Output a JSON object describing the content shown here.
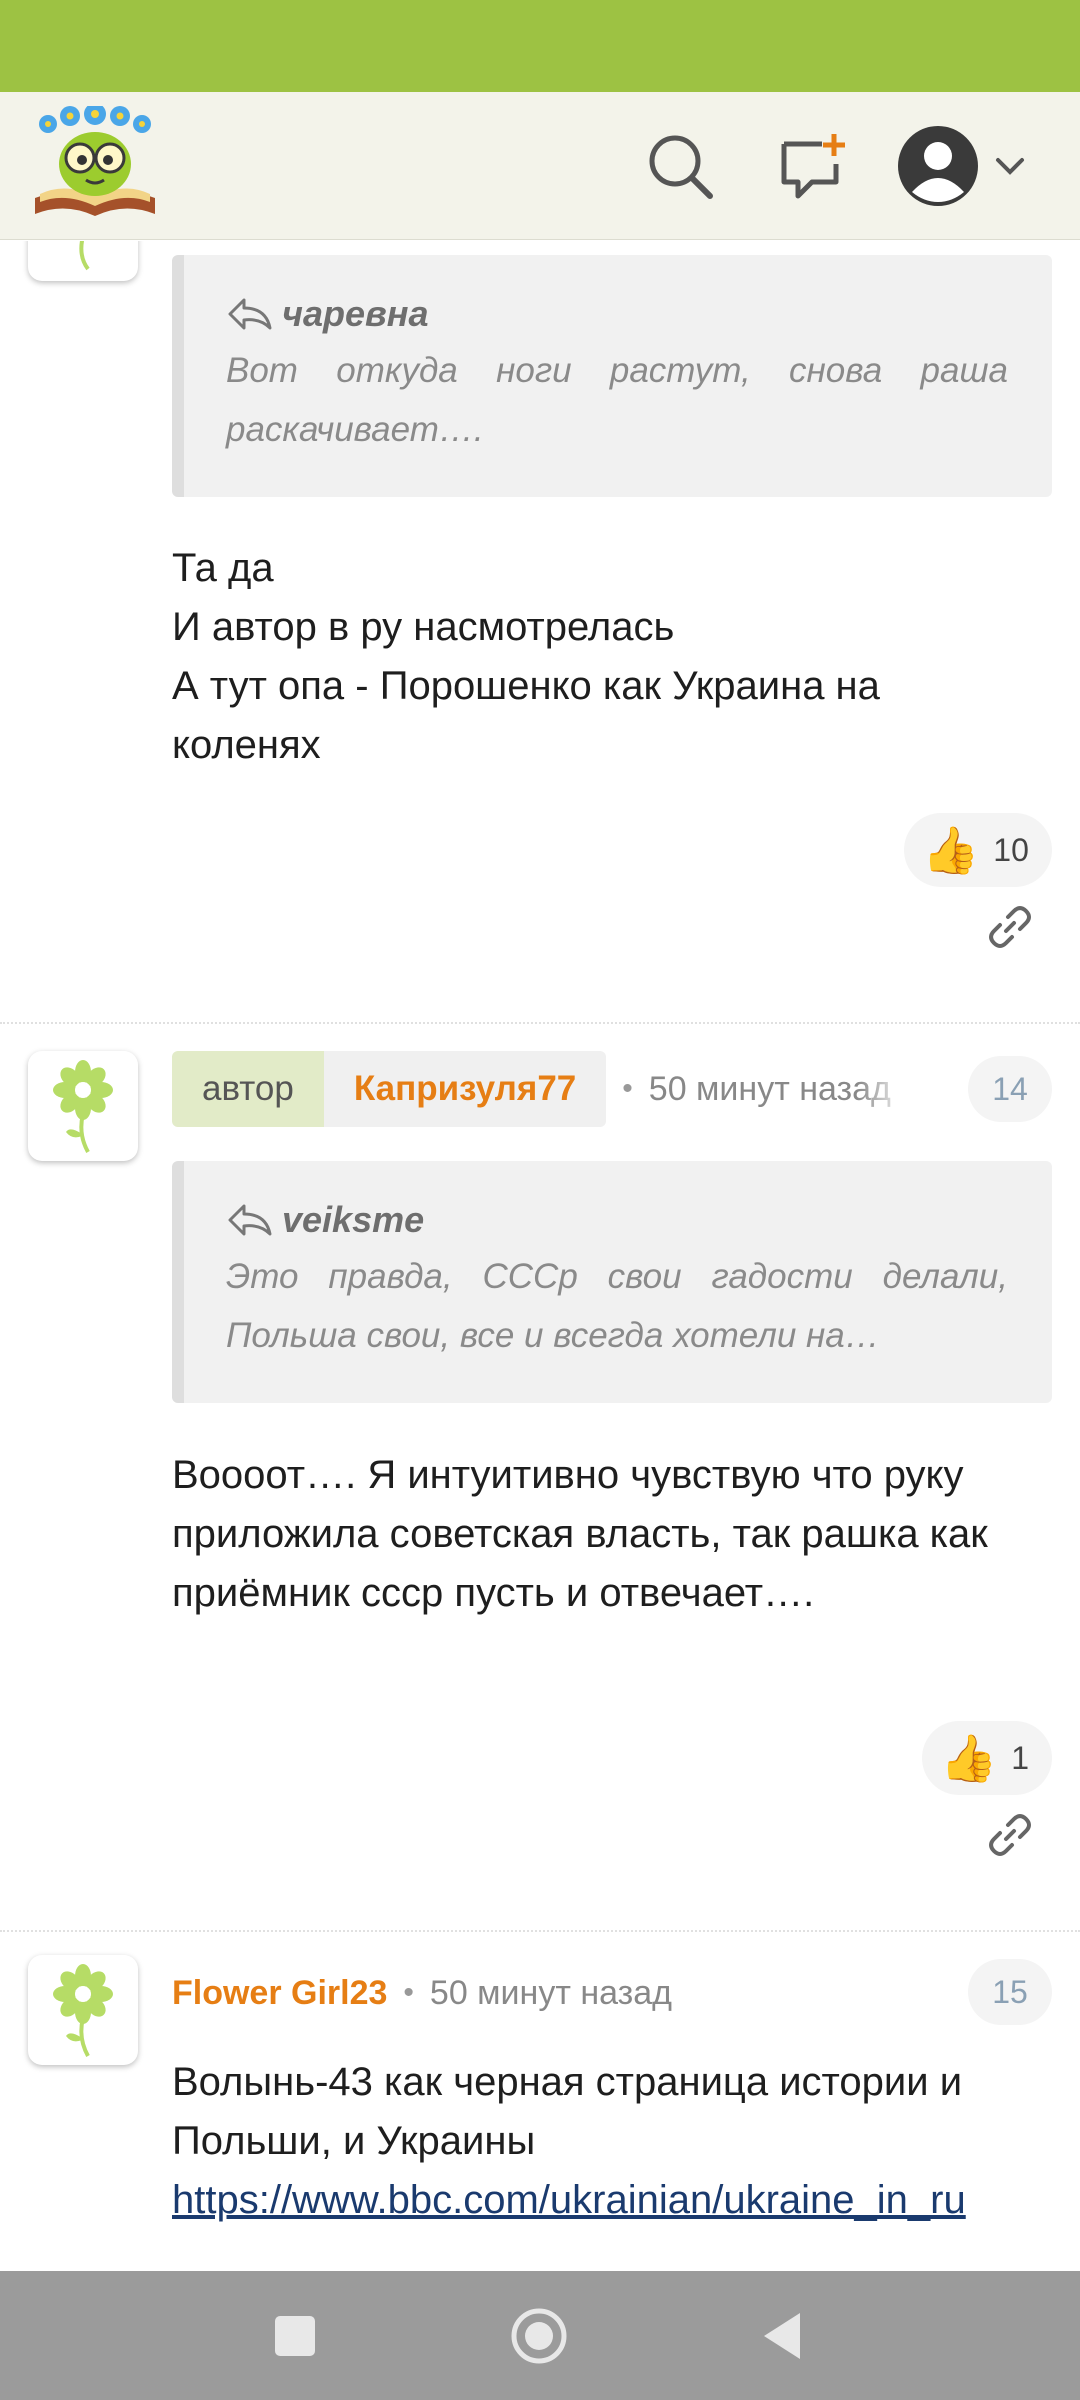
{
  "colors": {
    "status_bar": "#9dc243",
    "accent_orange": "#e67e14",
    "nav_bar": "#9b9b9b"
  },
  "header": {
    "logo_icon": "bookworm-logo",
    "search_icon": "search-icon",
    "new_message_icon": "chat-plus-icon",
    "account_icon": "account-circle-icon",
    "menu_chevron": "chevron-down-icon"
  },
  "comments": [
    {
      "quote": {
        "author": "чаревна",
        "text": "Вот откуда ноги растут, снова раша раскачивает…."
      },
      "lines": [
        "Та да",
        "И автор в ру насмотрелась",
        "А тут опа - Порошенко как Украина на коленях"
      ],
      "likes": "10"
    },
    {
      "author_tag": "автор",
      "author": "Капризуля77",
      "time": "50 минут назад",
      "number": "14",
      "quote": {
        "author": "veiksme",
        "text": "Это правда, СССр свои гадости делали, Польша свои, все и всегда хотели на…"
      },
      "lines": [
        "Воооот…. Я интуитивно чувствую что руку приложила советская власть, так рашка как приёмник ссср пусть и отвечает…."
      ],
      "likes": "1"
    },
    {
      "author": "Flower Girl23",
      "time": "50 минут назад",
      "number": "15",
      "lines": [
        "Волынь-43 как черная страница истории и Польши, и Украины"
      ],
      "link": "https://www.bbc.com/ukrainian/ukraine_in_ru"
    }
  ]
}
